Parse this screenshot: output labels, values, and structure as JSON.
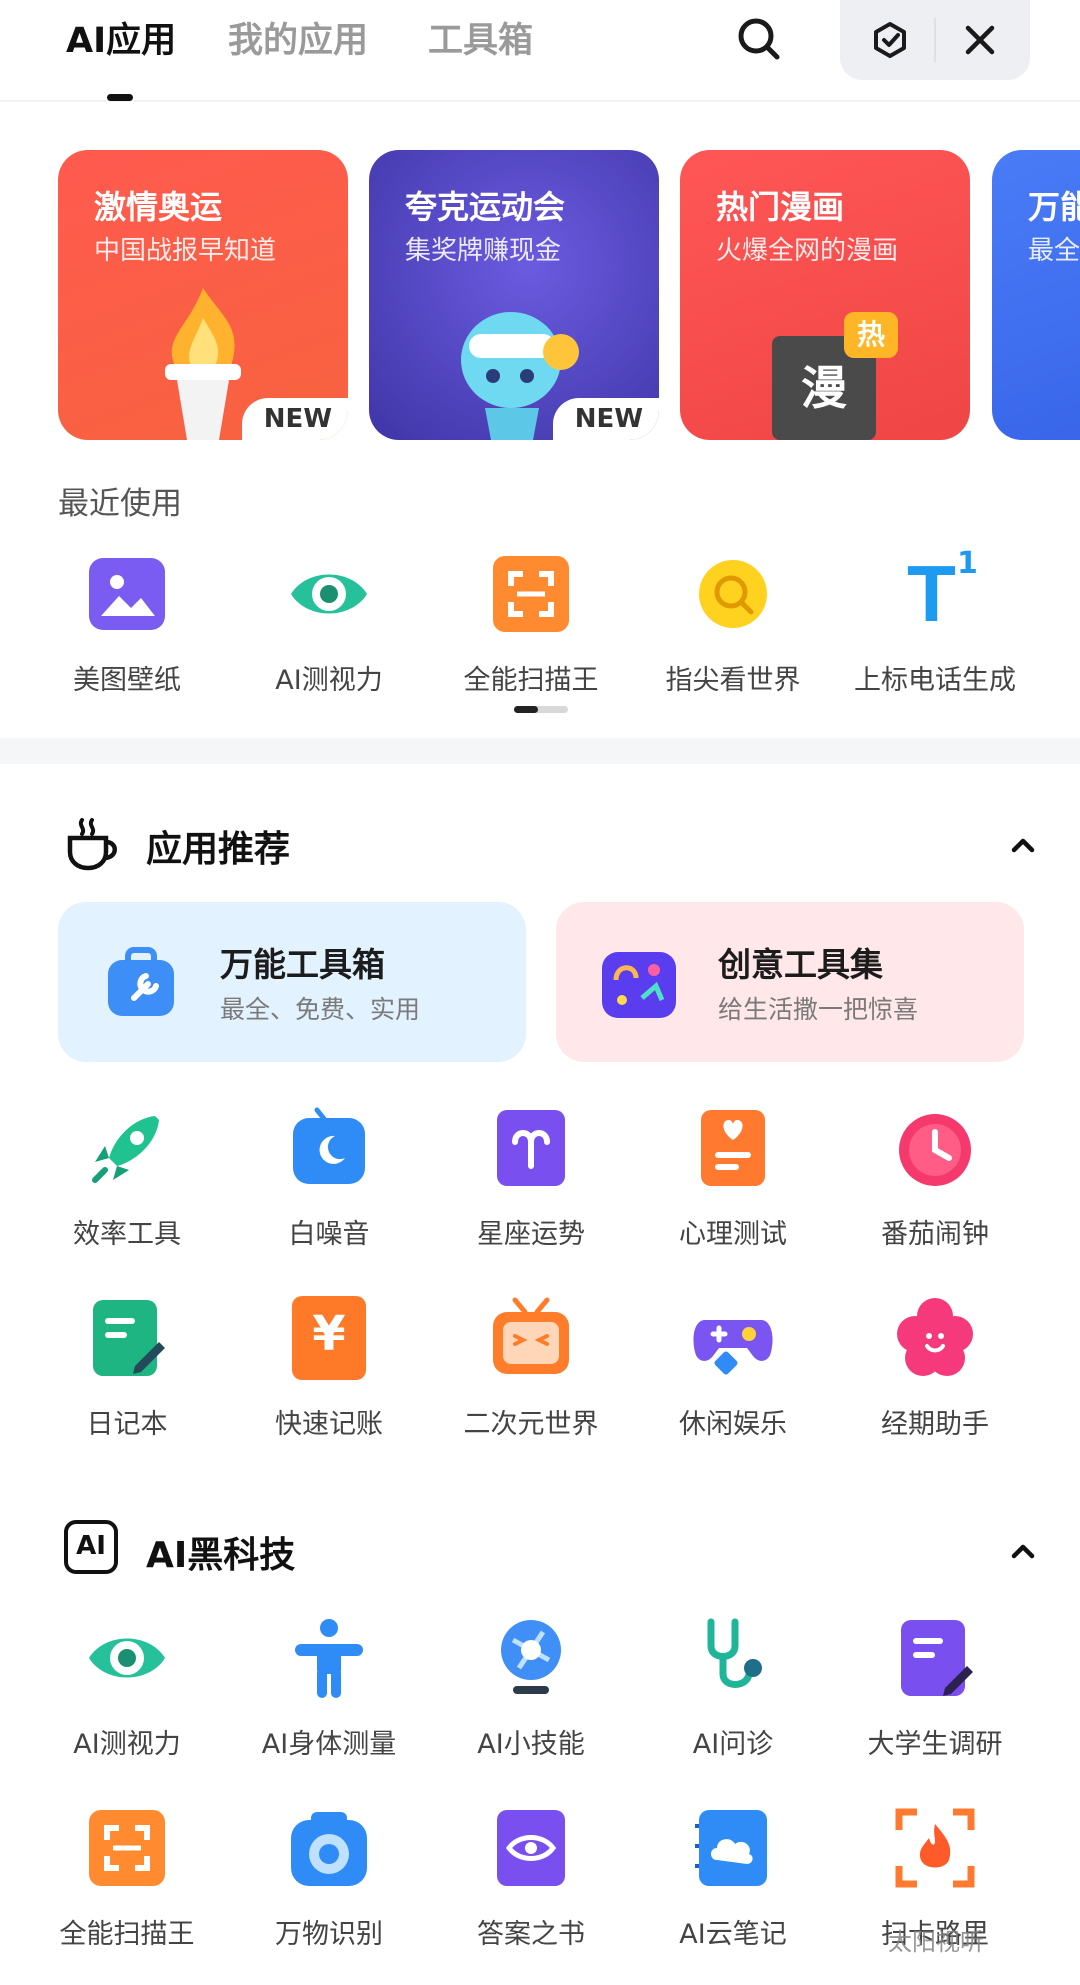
{
  "tabs": [
    {
      "label": "AI应用",
      "active": true
    },
    {
      "label": "我的应用",
      "active": false
    },
    {
      "label": "工具箱",
      "active": false
    }
  ],
  "banners": [
    {
      "title": "激情奥运",
      "subtitle": "中国战报早知道",
      "badge": "NEW",
      "color": "#f7564c"
    },
    {
      "title": "夸克运动会",
      "subtitle": "集奖牌赚现金",
      "badge": "NEW",
      "color": "#4b3fb3"
    },
    {
      "title": "热门漫画",
      "subtitle": "火爆全网的漫画",
      "badge_text": "热",
      "book_text": "漫",
      "color": "#f24b4b"
    },
    {
      "title": "万能",
      "subtitle": "最全",
      "color": "#3d6df2"
    }
  ],
  "recent": {
    "label": "最近使用",
    "items": [
      {
        "label": "美图壁纸",
        "icon": "wallpaper-icon"
      },
      {
        "label": "AI测视力",
        "icon": "eye-test-icon"
      },
      {
        "label": "全能扫描王",
        "icon": "scanner-icon"
      },
      {
        "label": "指尖看世界",
        "icon": "magnifier-icon"
      },
      {
        "label": "上标电话生成",
        "icon": "superscript-icon",
        "glyph": "T",
        "sup": "1"
      }
    ]
  },
  "app_recommend": {
    "title": "应用推荐",
    "cards": [
      {
        "title": "万能工具箱",
        "subtitle": "最全、免费、实用"
      },
      {
        "title": "创意工具集",
        "subtitle": "给生活撒一把惊喜"
      }
    ],
    "items": [
      {
        "label": "效率工具",
        "icon": "rocket-icon"
      },
      {
        "label": "白噪音",
        "icon": "white-noise-icon"
      },
      {
        "label": "星座运势",
        "icon": "horoscope-icon"
      },
      {
        "label": "心理测试",
        "icon": "psychology-test-icon"
      },
      {
        "label": "番茄闹钟",
        "icon": "pomodoro-clock-icon"
      },
      {
        "label": "日记本",
        "icon": "diary-icon"
      },
      {
        "label": "快速记账",
        "icon": "bookkeeping-icon",
        "glyph": "¥"
      },
      {
        "label": "二次元世界",
        "icon": "anime-tv-icon"
      },
      {
        "label": "休闲娱乐",
        "icon": "gamepad-icon"
      },
      {
        "label": "经期助手",
        "icon": "period-helper-icon"
      }
    ]
  },
  "ai_tech": {
    "title": "AI黑科技",
    "icon_text": "AI",
    "items": [
      {
        "label": "AI测视力",
        "icon": "eye-test-icon"
      },
      {
        "label": "AI身体测量",
        "icon": "body-measure-icon"
      },
      {
        "label": "AI小技能",
        "icon": "ai-skill-icon"
      },
      {
        "label": "AI问诊",
        "icon": "stethoscope-icon"
      },
      {
        "label": "大学生调研",
        "icon": "survey-icon"
      },
      {
        "label": "全能扫描王",
        "icon": "scanner-icon"
      },
      {
        "label": "万物识别",
        "icon": "camera-recognize-icon"
      },
      {
        "label": "答案之书",
        "icon": "answer-book-icon"
      },
      {
        "label": "AI云笔记",
        "icon": "cloud-note-icon"
      },
      {
        "label": "扫卡路里",
        "icon": "calorie-scan-icon"
      }
    ]
  },
  "watermark": "太阳视听"
}
